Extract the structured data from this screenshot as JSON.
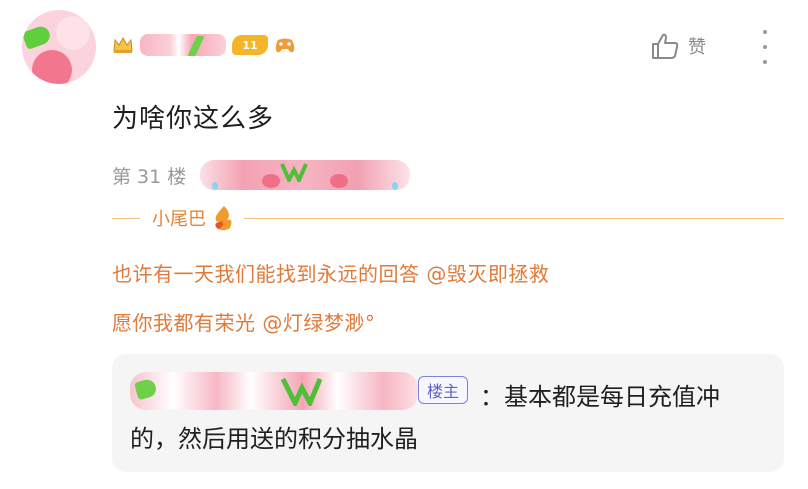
{
  "post": {
    "content": "为啥你这么多",
    "floor": "第 31 楼",
    "level": "11",
    "like_label": "赞"
  },
  "tail": {
    "label": "小尾巴",
    "line1": "也许有一天我们能找到永远的回答 @毁灭即拯救",
    "line2": "愿你我都有荣光 @灯绿梦渺°"
  },
  "reply": {
    "owner_badge": "楼主",
    "text": "：基本都是每日充值冲的，然后用送的积分抽水晶"
  },
  "colors": {
    "tail_text": "#e07a3a",
    "owner_badge": "#5a63c9",
    "level_badge": "#f4b52b"
  },
  "icons": [
    "crown-icon",
    "level-badge",
    "gamepad-icon",
    "like-icon",
    "more-icon",
    "flame-icon"
  ]
}
